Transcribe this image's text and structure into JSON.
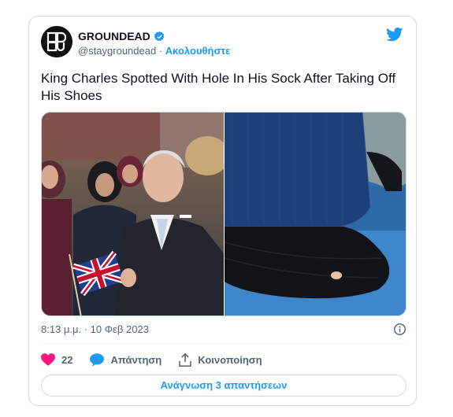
{
  "account": {
    "name": "GROUNDEAD",
    "handle": "@staygroundead",
    "separator": " · ",
    "follow_label": "Ακολουθήστε",
    "avatar_letters": "GD"
  },
  "tweet": {
    "text": "King Charles Spotted With Hole In His Sock After Taking Off His Shoes",
    "timestamp": "8:13 μ.μ. · 10 Φεβ 2023"
  },
  "actions": {
    "like_count": "22",
    "reply_label": "Απάντηση",
    "share_label": "Κοινοποίηση"
  },
  "read_replies_label": "Ανάγνωση 3 απαντήσεων",
  "colors": {
    "accent": "#1d9bf0",
    "like": "#f91880",
    "text_secondary": "#536471",
    "border": "#cfd9de"
  },
  "icons": [
    "verified-badge-icon",
    "twitter-bird-icon",
    "info-icon",
    "heart-icon",
    "reply-bubble-icon",
    "share-icon"
  ]
}
